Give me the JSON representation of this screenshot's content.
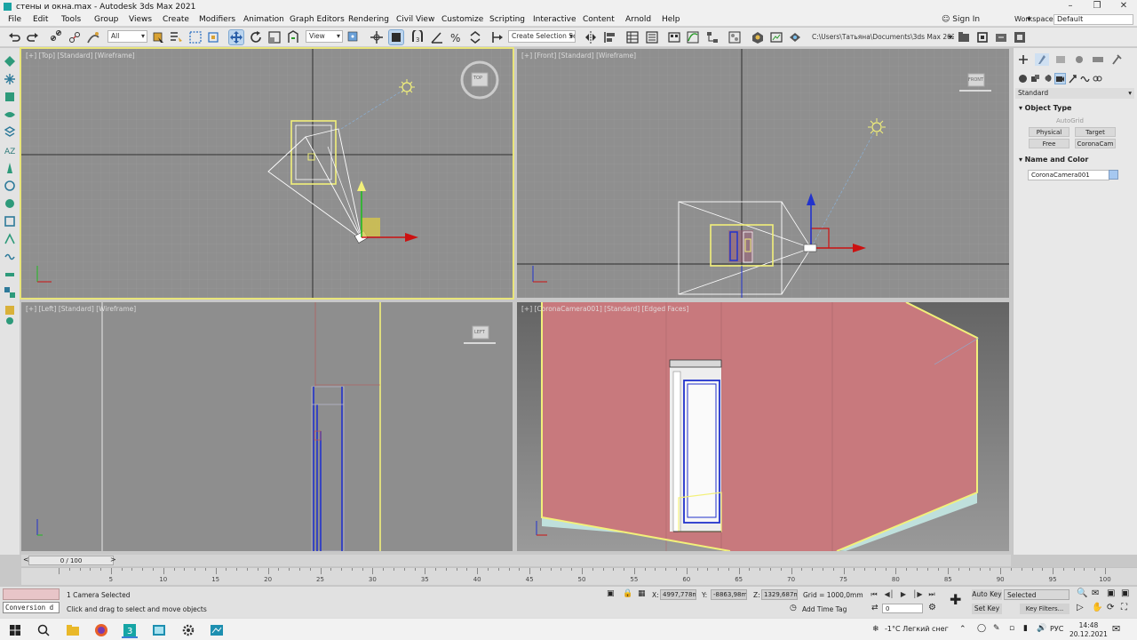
{
  "window": {
    "title": "стены и окна.max - Autodesk 3ds Max 2021"
  },
  "menu": {
    "items": [
      "File",
      "Edit",
      "Tools",
      "Group",
      "Views",
      "Create",
      "Modifiers",
      "Animation",
      "Graph Editors",
      "Rendering",
      "Civil View",
      "Customize",
      "Scripting",
      "Interactive",
      "Content",
      "Arnold",
      "Help"
    ],
    "sign_in": "Sign In",
    "workspaces_label": "Workspaces:",
    "workspace_value": "Default"
  },
  "toolbar": {
    "filter_value": "All",
    "refcoord_value": "View",
    "selection_set_placeholder": "Create Selection Se",
    "project_path": "C:\\Users\\Татьяна\\Documents\\3ds Max 2021"
  },
  "viewports": {
    "top": {
      "label": "[+] [Top] [Standard] [Wireframe]",
      "cube_label": "TOP"
    },
    "front": {
      "label": "[+] [Front] [Standard] [Wireframe]",
      "cube_label": "FRONT"
    },
    "left": {
      "label": "[+] [Left] [Standard] [Wireframe]",
      "cube_label": "LEFT"
    },
    "camera": {
      "label": "[+] [CoronaCamera001] [Standard] [Edged Faces]"
    }
  },
  "command_panel": {
    "category": "Standard",
    "object_type_title": "Object Type",
    "autogrid": "AutoGrid",
    "buttons": [
      "Physical",
      "Target",
      "Free",
      "CoronaCam"
    ],
    "name_color_title": "Name and Color",
    "object_name": "CoronaCamera001",
    "object_color": "#a6c8f0"
  },
  "timeline": {
    "slider_text": "0 / 100",
    "ticks": [
      0,
      5,
      10,
      15,
      20,
      25,
      30,
      35,
      40,
      45,
      50,
      55,
      60,
      65,
      70,
      75,
      80,
      85,
      90,
      95,
      100
    ]
  },
  "status": {
    "maxscript": "Conversion d",
    "selection": "1 Camera Selected",
    "prompt": "Click and drag to select and move objects",
    "x_label": "X:",
    "x_value": "4997,778m",
    "y_label": "Y:",
    "y_value": "-8863,98m",
    "z_label": "Z:",
    "z_value": "1329,687m",
    "grid": "Grid = 1000,0mm",
    "add_time_tag": "Add Time Tag",
    "frame": "0",
    "auto_key": "Auto Key",
    "set_key": "Set Key",
    "selected": "Selected",
    "key_filters": "Key Filters..."
  },
  "taskbar": {
    "weather": "-1°C  Легкий снег",
    "lang": "РУС",
    "time": "14:48",
    "date": "20.12.2021"
  },
  "colors": {
    "wall": "#c8797d",
    "selection_yellow": "#f2f07a",
    "axis_red": "#cc1111",
    "axis_green": "#22bb22",
    "axis_blue": "#2233cc"
  }
}
